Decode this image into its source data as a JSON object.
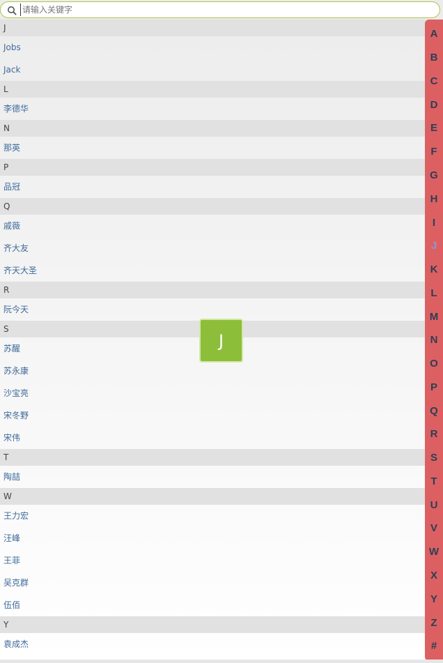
{
  "search": {
    "placeholder": "请输入关键字",
    "value": ""
  },
  "sections": [
    {
      "letter": "J",
      "contacts": [
        "Jobs",
        "Jack"
      ]
    },
    {
      "letter": "L",
      "contacts": [
        "李德华"
      ]
    },
    {
      "letter": "N",
      "contacts": [
        "那英"
      ]
    },
    {
      "letter": "P",
      "contacts": [
        "品冠"
      ]
    },
    {
      "letter": "Q",
      "contacts": [
        "戚薇",
        "齐大友",
        "齐天大圣"
      ]
    },
    {
      "letter": "R",
      "contacts": [
        "阮今天"
      ]
    },
    {
      "letter": "S",
      "contacts": [
        "苏醒",
        "苏永康",
        "沙宝亮",
        "宋冬野",
        "宋伟"
      ]
    },
    {
      "letter": "T",
      "contacts": [
        "陶喆"
      ]
    },
    {
      "letter": "W",
      "contacts": [
        "王力宏",
        "汪峰",
        "王菲",
        "吴克群",
        "伍佰"
      ]
    },
    {
      "letter": "Y",
      "contacts": [
        "袁成杰"
      ]
    }
  ],
  "index_letters": [
    "A",
    "B",
    "C",
    "D",
    "E",
    "F",
    "G",
    "H",
    "I",
    "J",
    "K",
    "L",
    "M",
    "N",
    "O",
    "P",
    "Q",
    "R",
    "S",
    "T",
    "U",
    "V",
    "W",
    "X",
    "Y",
    "Z",
    "#"
  ],
  "index_active": "J",
  "overlay_letter": "J",
  "colors": {
    "search_border": "#a8c84a",
    "section_header_bg": "#e1e1e1",
    "contact_text": "#3e6a9a",
    "index_bar_bg": "#dc6062",
    "index_letter": "#2c3e55",
    "index_active": "#8a98d8",
    "overlay_bg": "#8cbe3a"
  }
}
